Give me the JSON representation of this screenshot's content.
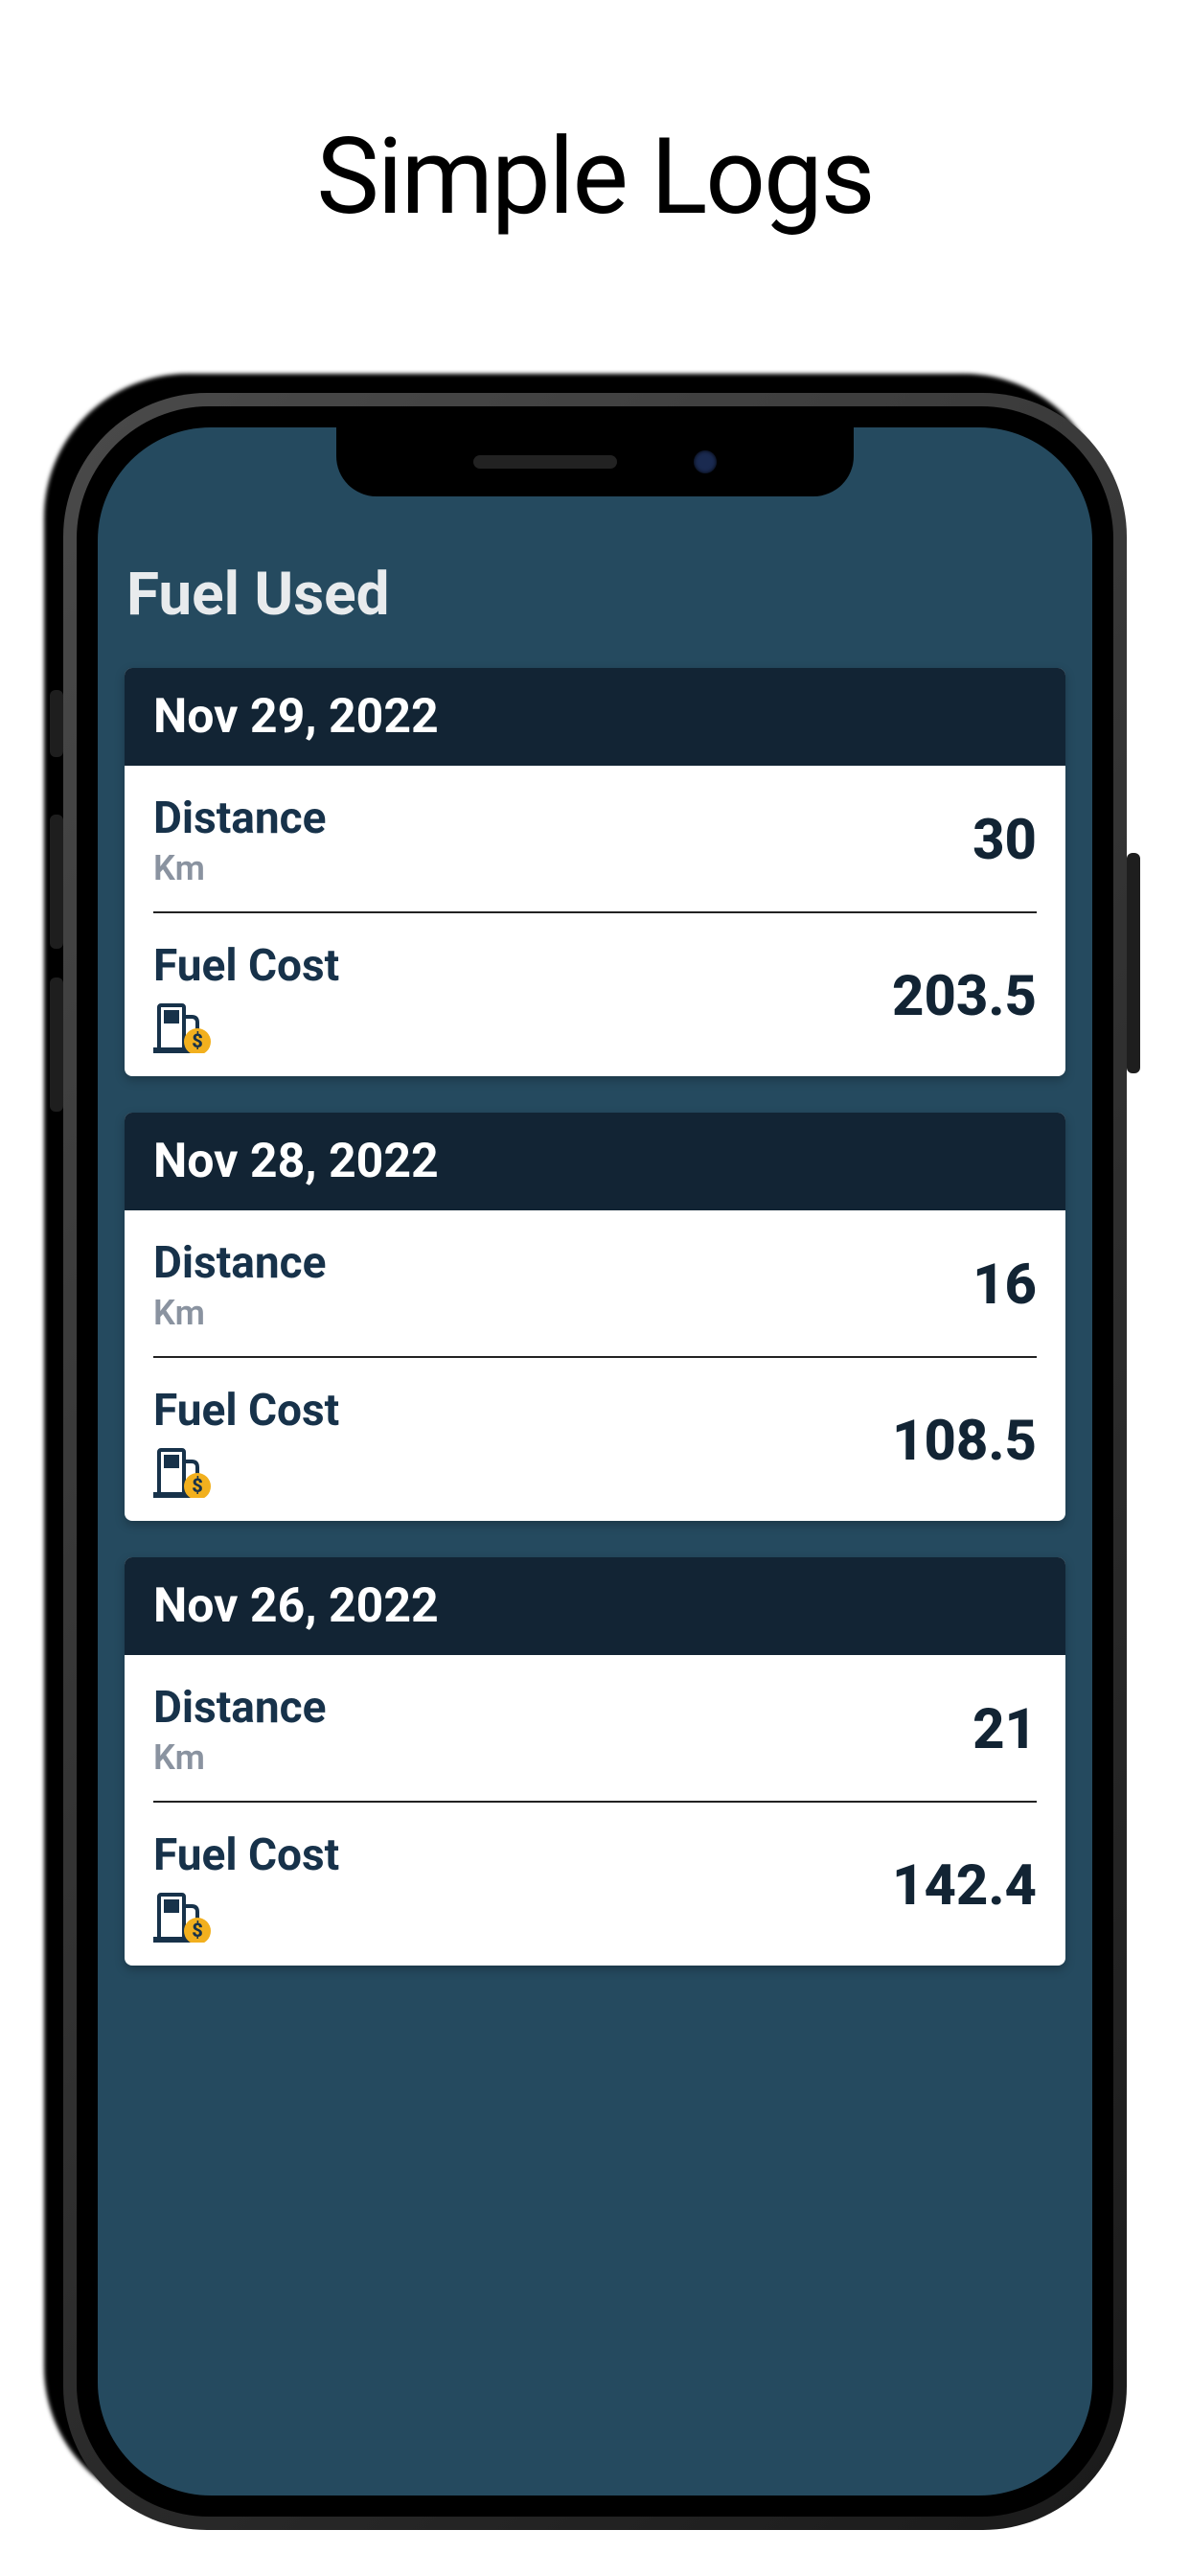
{
  "marketing": {
    "title": "Simple Logs"
  },
  "app": {
    "title": "Fuel Used"
  },
  "labels": {
    "distance": "Distance",
    "distance_unit": "Km",
    "fuel_cost": "Fuel Cost"
  },
  "logs": [
    {
      "date": "Nov 29, 2022",
      "distance": "30",
      "fuel_cost": "203.5"
    },
    {
      "date": "Nov 28, 2022",
      "distance": "16",
      "fuel_cost": "108.5"
    },
    {
      "date": "Nov 26, 2022",
      "distance": "21",
      "fuel_cost": "142.4"
    }
  ],
  "colors": {
    "app_bg": "#254a5f",
    "card_header": "#122434",
    "text_dark": "#17324a",
    "accent": "#f2b01e"
  }
}
